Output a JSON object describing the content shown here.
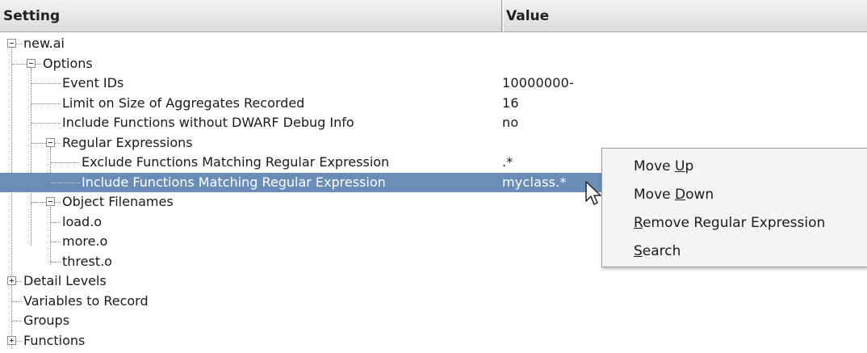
{
  "header": {
    "setting_label": "Setting",
    "value_label": "Value"
  },
  "tree": [
    {
      "label": "new.ai",
      "value": ""
    },
    {
      "label": "Options",
      "value": ""
    },
    {
      "label": "Event IDs",
      "value": "10000000-"
    },
    {
      "label": "Limit on Size of Aggregates Recorded",
      "value": "16"
    },
    {
      "label": "Include Functions without DWARF Debug Info",
      "value": "no"
    },
    {
      "label": "Regular Expressions",
      "value": ""
    },
    {
      "label": "Exclude Functions Matching Regular Expression",
      "value": ".*"
    },
    {
      "label": "Include Functions Matching Regular Expression",
      "value": "myclass.*",
      "selected": true
    },
    {
      "label": "Object Filenames",
      "value": ""
    },
    {
      "label": "load.o",
      "value": ""
    },
    {
      "label": "more.o",
      "value": ""
    },
    {
      "label": "threst.o",
      "value": ""
    },
    {
      "label": "Detail Levels",
      "value": ""
    },
    {
      "label": "Variables to Record",
      "value": ""
    },
    {
      "label": "Groups",
      "value": ""
    },
    {
      "label": "Functions",
      "value": ""
    }
  ],
  "context_menu": {
    "items": [
      {
        "label": "Move Up",
        "mnemonic": "U"
      },
      {
        "label": "Move Down",
        "mnemonic": "D"
      },
      {
        "label": "Remove Regular Expression",
        "mnemonic": "R"
      },
      {
        "label": "Search",
        "mnemonic": "S"
      }
    ]
  },
  "colors": {
    "selection": "#6a8db7",
    "header_bg": "#dcdcdc",
    "menu_bg": "#f4f4f4"
  },
  "icons": [
    "expand-collapse-icon",
    "mouse-pointer-icon"
  ]
}
